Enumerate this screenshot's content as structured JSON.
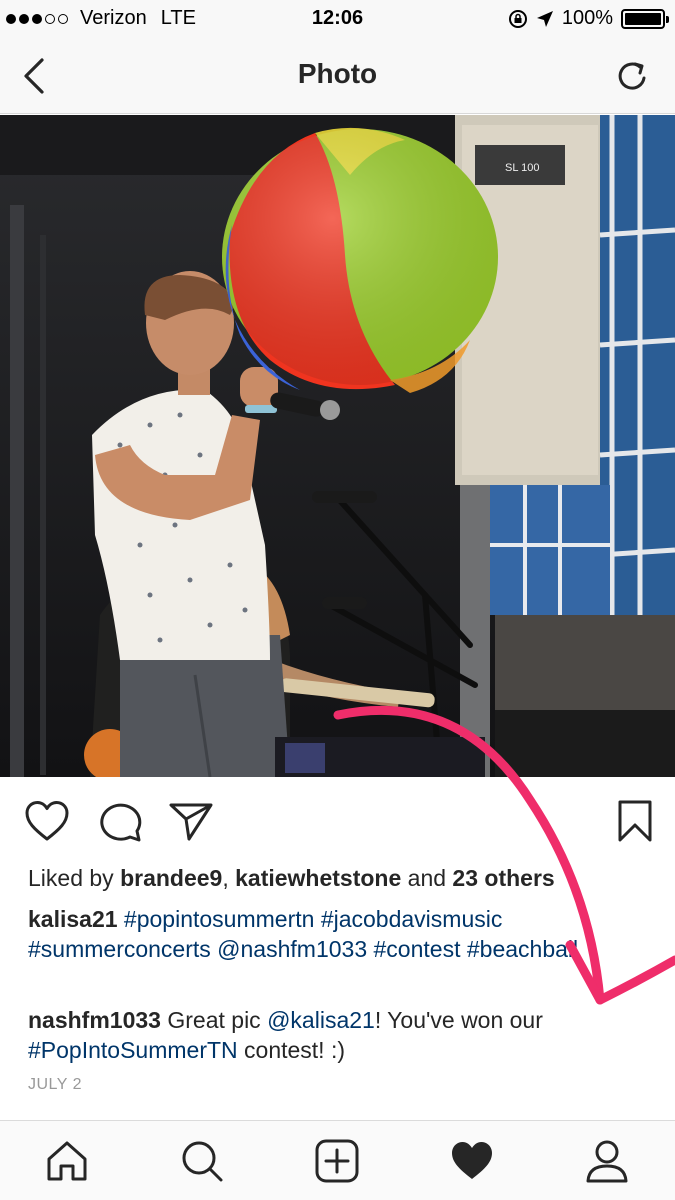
{
  "status_bar": {
    "carrier": "Verizon",
    "network": "LTE",
    "time": "12:06",
    "battery": "100%",
    "battery_level": 1.0
  },
  "nav": {
    "title": "Photo",
    "back_icon": "chevron-left-icon",
    "refresh_icon": "refresh-icon"
  },
  "post": {
    "likes": {
      "prefix": "Liked by ",
      "user1": "brandee9",
      "sep": ", ",
      "user2": "katiewhetstone",
      "and": " and ",
      "others": "23 others"
    },
    "caption": {
      "user": "kalisa21",
      "tags": [
        "#popintosummertn",
        "#jacobdavismusic",
        "#summerconcerts",
        "@nashfm1033",
        "#contest",
        "#beachball"
      ]
    },
    "comment": {
      "user": "nashfm1033",
      "text1": " Great pic ",
      "mention": "@kalisa21",
      "text2": "! You've won our ",
      "hashtag": "#PopIntoSummerTN",
      "text3": " contest! :)"
    },
    "date": "JULY 2",
    "photo_sign_text": "SL 100"
  },
  "colors": {
    "hashtag": "#003569",
    "annotation_arrow": "#ef2d6a"
  },
  "tab_bar": {
    "icons": [
      "home-icon",
      "search-icon",
      "add-post-icon",
      "activity-heart-icon",
      "profile-icon"
    ]
  }
}
